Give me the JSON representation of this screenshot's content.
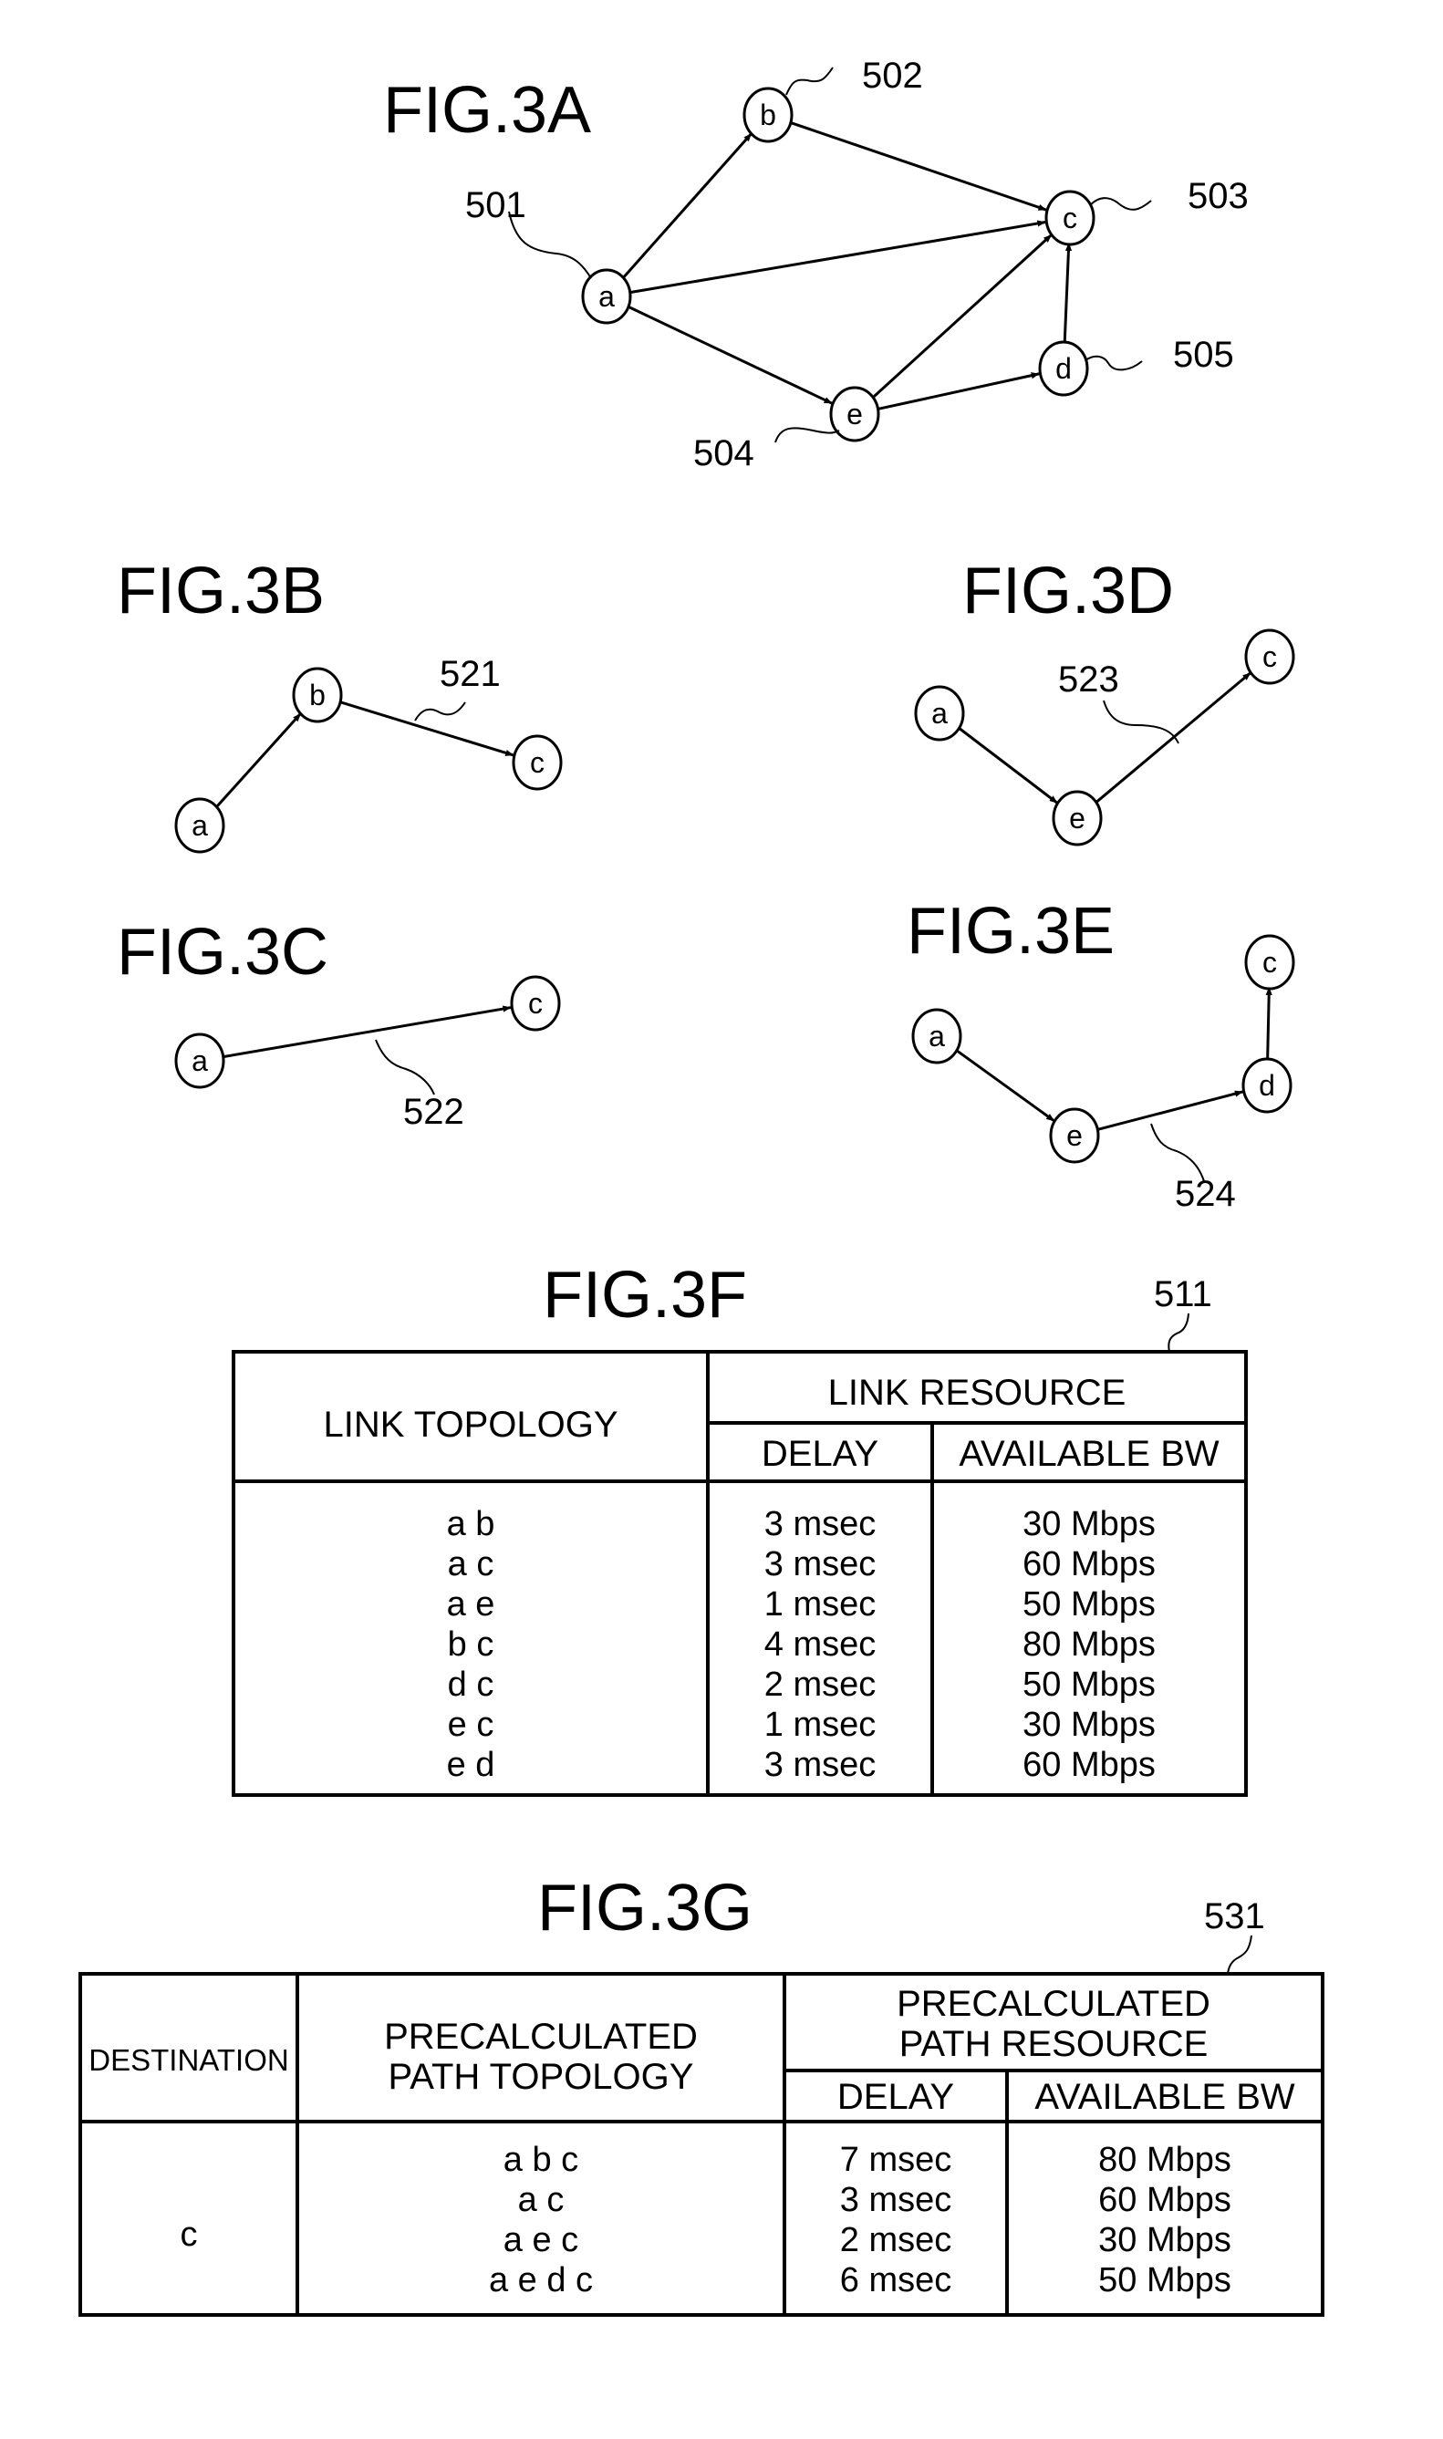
{
  "fig3a": {
    "title": "FIG.3A",
    "nodes": [
      {
        "id": "a",
        "label": "a",
        "ref": "501"
      },
      {
        "id": "b",
        "label": "b",
        "ref": "502"
      },
      {
        "id": "c",
        "label": "c",
        "ref": "503"
      },
      {
        "id": "e",
        "label": "e",
        "ref": "504"
      },
      {
        "id": "d",
        "label": "d",
        "ref": "505"
      }
    ],
    "edges": [
      {
        "from": "a",
        "to": "b"
      },
      {
        "from": "b",
        "to": "c"
      },
      {
        "from": "a",
        "to": "c"
      },
      {
        "from": "a",
        "to": "e"
      },
      {
        "from": "e",
        "to": "c"
      },
      {
        "from": "e",
        "to": "d"
      },
      {
        "from": "d",
        "to": "c"
      }
    ]
  },
  "fig3b": {
    "title": "FIG.3B",
    "ref": "521",
    "path": [
      "a",
      "b",
      "c"
    ]
  },
  "fig3c": {
    "title": "FIG.3C",
    "ref": "522",
    "path": [
      "a",
      "c"
    ]
  },
  "fig3d": {
    "title": "FIG.3D",
    "ref": "523",
    "path": [
      "a",
      "e",
      "c"
    ]
  },
  "fig3e": {
    "title": "FIG.3E",
    "ref": "524",
    "path": [
      "a",
      "e",
      "d",
      "c"
    ]
  },
  "fig3f": {
    "title": "FIG.3F",
    "ref": "511",
    "headers": {
      "topology": "LINK TOPOLOGY",
      "resource": "LINK RESOURCE",
      "delay": "DELAY",
      "bw": "AVAILABLE BW"
    },
    "rows": [
      {
        "topology": "a b",
        "delay": "3 msec",
        "bw": "30 Mbps"
      },
      {
        "topology": "a c",
        "delay": "3 msec",
        "bw": "60 Mbps"
      },
      {
        "topology": "a e",
        "delay": "1 msec",
        "bw": "50 Mbps"
      },
      {
        "topology": "b c",
        "delay": "4 msec",
        "bw": "80 Mbps"
      },
      {
        "topology": "d c",
        "delay": "2 msec",
        "bw": "50 Mbps"
      },
      {
        "topology": "e c",
        "delay": "1 msec",
        "bw": "30 Mbps"
      },
      {
        "topology": "e d",
        "delay": "3 msec",
        "bw": "60 Mbps"
      }
    ]
  },
  "fig3g": {
    "title": "FIG.3G",
    "ref": "531",
    "headers": {
      "destination": "DESTINATION",
      "topology_line1": "PRECALCULATED",
      "topology_line2": "PATH TOPOLOGY",
      "resource_line1": "PRECALCULATED",
      "resource_line2": "PATH RESOURCE",
      "delay": "DELAY",
      "bw": "AVAILABLE BW"
    },
    "destination": "c",
    "rows": [
      {
        "topology": "a b c",
        "delay": "7 msec",
        "bw": "80 Mbps"
      },
      {
        "topology": "a c",
        "delay": "3 msec",
        "bw": "60 Mbps"
      },
      {
        "topology": "a e c",
        "delay": "2 msec",
        "bw": "30 Mbps"
      },
      {
        "topology": "a e d c",
        "delay": "6 msec",
        "bw": "50 Mbps"
      }
    ]
  }
}
